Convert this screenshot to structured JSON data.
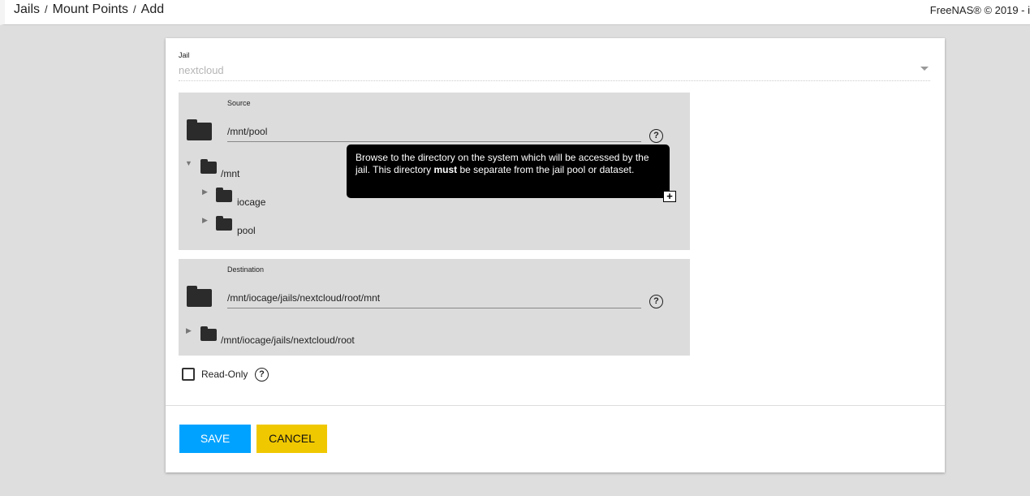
{
  "header": {
    "breadcrumbs": [
      "Jails",
      "Mount Points",
      "Add"
    ],
    "separator": "/",
    "copyright": "FreeNAS® © 2019 - i"
  },
  "form": {
    "jail": {
      "label": "Jail",
      "value": "nextcloud"
    },
    "source": {
      "label": "Source",
      "value": "/mnt/pool",
      "help": "?",
      "tooltip": {
        "before": "Browse to the directory on the system which will be accessed by the jail. This directory ",
        "bold": "must",
        "after": " be separate from the jail pool or dataset.",
        "expand": "+"
      },
      "tree": [
        {
          "name": "/mnt",
          "expanded": true
        },
        {
          "name": "iocage"
        },
        {
          "name": "pool"
        }
      ]
    },
    "destination": {
      "label": "Destination",
      "value": "/mnt/iocage/jails/nextcloud/root/mnt",
      "help": "?",
      "tree": [
        {
          "name": "/mnt/iocage/jails/nextcloud/root"
        }
      ]
    },
    "read_only": {
      "label": "Read-Only",
      "checked": false,
      "help": "?"
    },
    "save": "SAVE",
    "cancel": "CANCEL"
  },
  "colors": {
    "save": "#00a2ff",
    "cancel": "#f0c800"
  }
}
